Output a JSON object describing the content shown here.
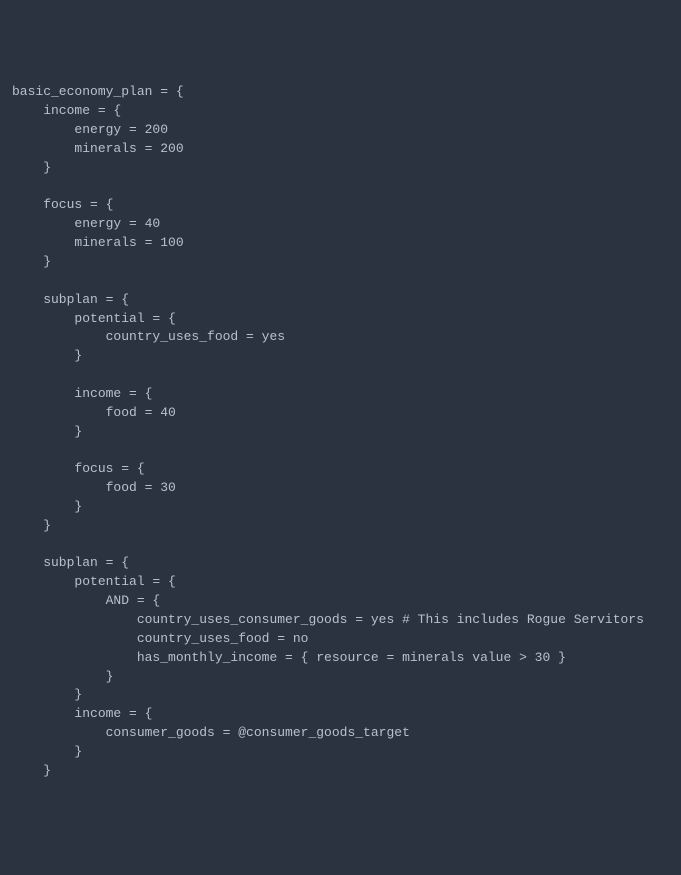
{
  "lines": [
    "basic_economy_plan = {",
    "    income = {",
    "        energy = 200",
    "        minerals = 200",
    "    }",
    "",
    "    focus = {",
    "        energy = 40",
    "        minerals = 100",
    "    }",
    "",
    "    subplan = {",
    "        potential = {",
    "            country_uses_food = yes",
    "        }",
    "",
    "        income = {",
    "            food = 40",
    "        }",
    "",
    "        focus = {",
    "            food = 30",
    "        }",
    "    }",
    "",
    "    subplan = {",
    "        potential = {",
    "            AND = {",
    "                country_uses_consumer_goods = yes # This includes Rogue Servitors",
    "                country_uses_food = no",
    "                has_monthly_income = { resource = minerals value > 30 }",
    "            }",
    "        }",
    "        income = {",
    "            consumer_goods = @consumer_goods_target",
    "        }",
    "    }"
  ]
}
